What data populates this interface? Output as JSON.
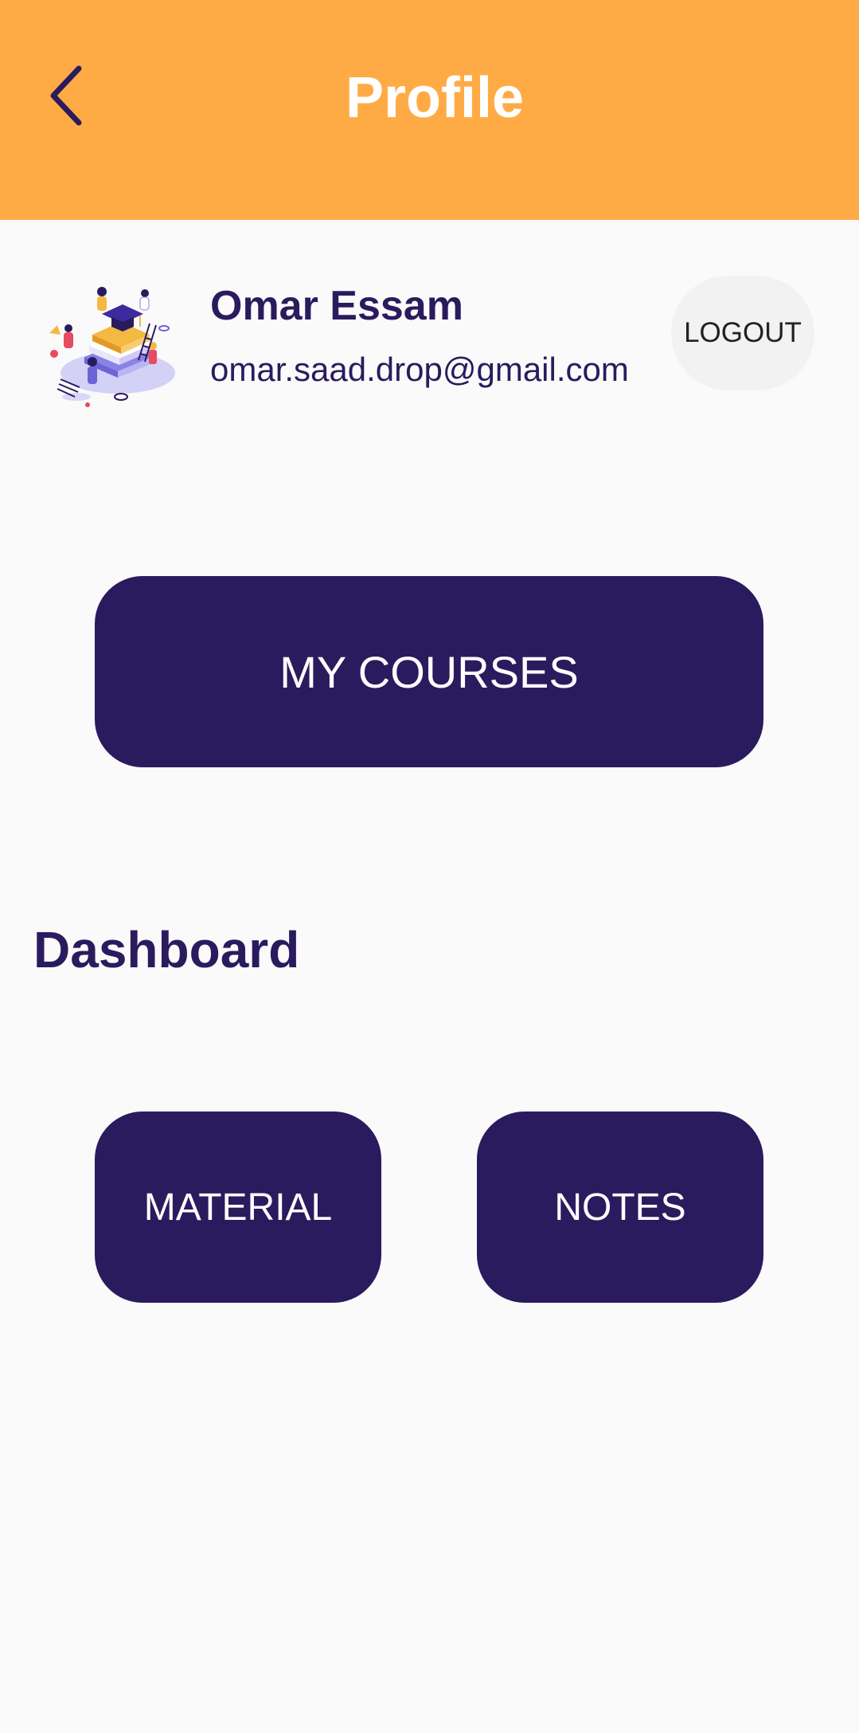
{
  "header": {
    "title": "Profile",
    "back_icon": "chevron-left-icon",
    "background_color": "#ffab45"
  },
  "profile": {
    "name": "Omar Essam",
    "email": "omar.saad.drop@gmail.com",
    "avatar": "education-illustration"
  },
  "actions": {
    "logout_label": "LOGOUT",
    "my_courses_label": "MY COURSES"
  },
  "dashboard": {
    "title": "Dashboard",
    "material_label": "MATERIAL",
    "notes_label": "NOTES"
  },
  "colors": {
    "primary": "#2a1b5e",
    "accent": "#ffab45",
    "background": "#fafafa"
  }
}
